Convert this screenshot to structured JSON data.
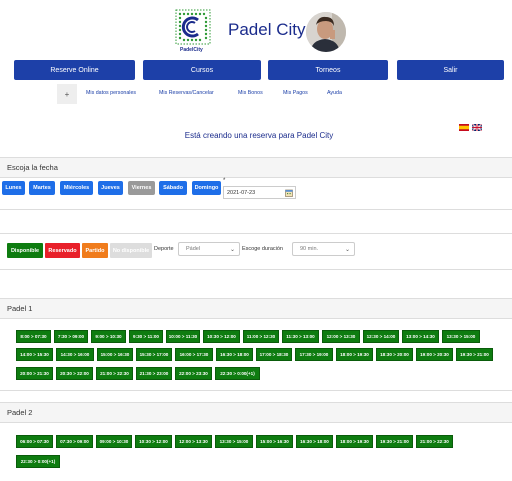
{
  "header": {
    "logo_text": "PadelCity",
    "brand": "Padel City"
  },
  "nav": [
    "Reserve Online",
    "Cursos",
    "Torneos",
    "Salir"
  ],
  "submenu": {
    "plus": "+",
    "items": [
      "Mis datos personales",
      "Mis Reservas/Cancelar",
      "Mis Bonos",
      "Mis Pagos",
      "Ayuda"
    ]
  },
  "notice": "Está creando una reserva para Padel City",
  "date_panel": {
    "title": "Escoja la fecha",
    "days": [
      "Lunes",
      "Martes",
      "Miércoles",
      "Jueves",
      "Viernes",
      "Sábado",
      "Domingo"
    ],
    "selected_day": "Viernes",
    "required_mark": "*",
    "date_value": "2021-07-23"
  },
  "filters": {
    "legend": [
      "Disponible",
      "Reservado",
      "Partido",
      "No disponible"
    ],
    "sport_label": "Deporte",
    "sport_value": "Pádel",
    "duration_label": "Escoge duración",
    "duration_value": "90 min."
  },
  "courts": [
    {
      "name": "Padel 1",
      "slots": [
        "8:00 > 07:30",
        "7:30 > 09:00",
        "9:00 > 10:30",
        "9:30 > 11:00",
        "10:00 > 11:30",
        "10:30 > 12:00",
        "11:00 > 12:30",
        "11:30 > 13:00",
        "12:00 > 13:30",
        "12:30 > 14:00",
        "13:00 > 14:30",
        "13:30 > 15:00",
        "14:00 > 15:30",
        "14:30 > 16:00",
        "15:00 > 16:30",
        "15:30 > 17:00",
        "16:00 > 17:30",
        "16:30 > 18:00",
        "17:00 > 18:30",
        "17:30 > 19:00",
        "18:00 > 19:30",
        "18:30 > 20:00",
        "19:00 > 20:30",
        "19:30 > 21:00",
        "20:00 > 21:30",
        "20:30 > 22:00",
        "21:00 > 22:30",
        "21:30 > 23:00",
        "22:00 > 23:30",
        "22:30 > 0:00(+1)"
      ]
    },
    {
      "name": "Padel 2",
      "slots": [
        "06:00 > 07:30",
        "07:30 > 09:00",
        "09:00 > 10:30",
        "10:30 > 12:00",
        "12:00 > 13:30",
        "13:30 > 15:00",
        "15:00 > 16:30",
        "16:30 > 18:00",
        "18:00 > 19:30",
        "19:30 > 21:00",
        "21:00 > 22:30",
        "22:30 > 0:00(+1)"
      ]
    }
  ],
  "colors": {
    "nav_blue": "#1d40a8",
    "day_blue": "#1e6ee8",
    "available": "#0e7c10",
    "reserved": "#e8202a",
    "match": "#f07c1c",
    "unavailable": "#dddddd"
  }
}
